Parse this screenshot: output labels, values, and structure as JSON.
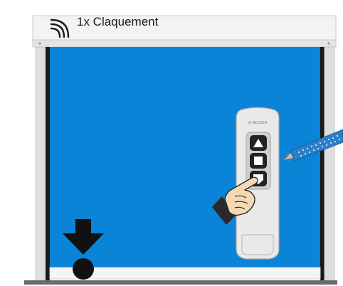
{
  "instruction": {
    "label": "1x Claquement",
    "sound_icon": "sound-waves-icon"
  },
  "remote": {
    "brand": "BECKER",
    "buttons": [
      {
        "name": "up-button",
        "icon": "triangle-up-icon"
      },
      {
        "name": "stop-button",
        "icon": "square-stop-icon"
      },
      {
        "name": "down-button",
        "icon": "triangle-down-icon"
      }
    ],
    "pressed_button": "down-button"
  },
  "icons": {
    "hand": "pointing-hand-icon",
    "pen": "programming-pen-icon",
    "end_position": "arrow-down-to-dot-icon"
  },
  "colors": {
    "curtain": "#0a84d6",
    "frame": "#d8d8d8",
    "rail": "#1a1a1a",
    "floor": "#6a6a6a",
    "pen": "#2c7fc8",
    "remote_body": "#e9e9e9"
  }
}
